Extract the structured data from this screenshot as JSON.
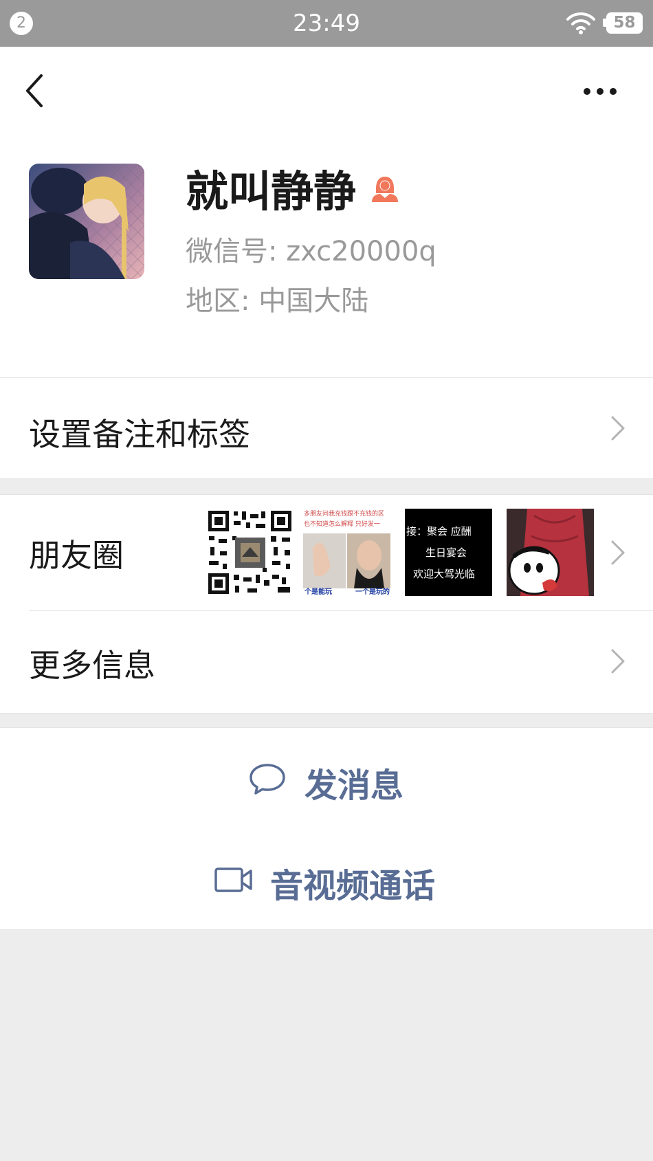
{
  "status_bar": {
    "notification_count": "2",
    "time": "23:49",
    "battery": "58"
  },
  "profile": {
    "name": "就叫静静",
    "wechat_id": "微信号: zxc20000q",
    "region": "地区: 中国大陆"
  },
  "menu": {
    "remark": "设置备注和标签",
    "moments": "朋友圈",
    "more_info": "更多信息"
  },
  "moments_thumbs": {
    "t2_line1": "多朋友问我充钱跟不充钱的区",
    "t2_line2": "也不知道怎么解释 只好发一",
    "t2_foot_left": "个是能玩",
    "t2_foot_right": "一个是玩的",
    "t3_line1": "接：聚会 应酬",
    "t3_line2": "生日宴会",
    "t3_line3": "欢迎大驾光临"
  },
  "actions": {
    "message": "发消息",
    "video_call": "音视频通话"
  },
  "colors": {
    "link": "#586c94",
    "status_bar": "#9a9a9a",
    "female": "#f2785c"
  }
}
